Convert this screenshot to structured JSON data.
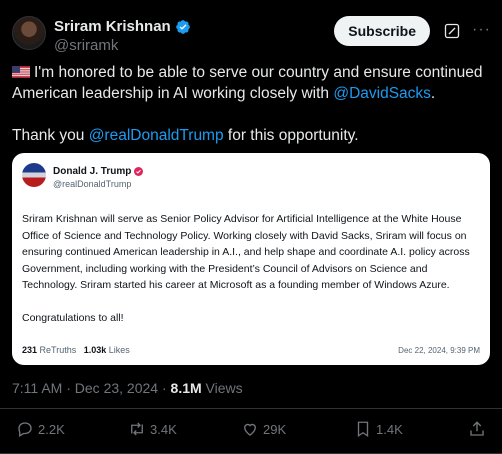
{
  "author": {
    "display_name": "Sriram Krishnan",
    "handle": "@sriramk"
  },
  "header": {
    "subscribe_label": "Subscribe",
    "more_label": "···"
  },
  "tweet": {
    "line1": "I'm honored to be able to serve our country and ensure continued American leadership in AI working closely with ",
    "mention1": "@DavidSacks",
    "line1_end": ".",
    "line2_start": "Thank you ",
    "mention2": "@realDonaldTrump",
    "line2_end": " for this opportunity."
  },
  "quote": {
    "display_name": "Donald J. Trump",
    "handle": "@realDonaldTrump",
    "body": "Sriram Krishnan will serve as Senior Policy Advisor for Artificial Intelligence at the White House Office of Science and Technology Policy. Working closely with David Sacks, Sriram will focus on ensuring continued American leadership in A.I., and help shape and coordinate A.I. policy across Government, including working with the President’s Council of Advisors on Science and Technology. Sriram started his career at Microsoft as a founding member of Windows Azure.",
    "closing": "Congratulations to all!",
    "retruths_count": "231",
    "retruths_label": "ReTruths",
    "likes_count": "1.03k",
    "likes_label": "Likes",
    "date": "Dec 22, 2024, 9:39 PM"
  },
  "meta": {
    "time": "7:11 AM",
    "separator": "·",
    "date": "Dec 23, 2024",
    "views_count": "8.1M",
    "views_label": "Views"
  },
  "actions": {
    "replies": "2.2K",
    "reposts": "3.4K",
    "likes": "29K",
    "bookmarks": "1.4K"
  },
  "colors": {
    "background": "#000000",
    "link": "#1d9bf0",
    "muted": "#71767b",
    "verified_blue": "#1d9bf0"
  }
}
